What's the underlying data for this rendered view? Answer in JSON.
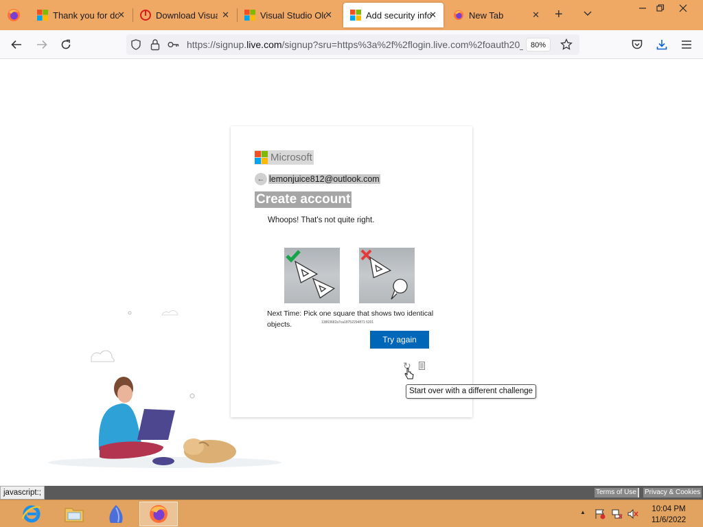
{
  "browser": {
    "tabs": [
      {
        "title": "Thank you for do",
        "icon": "microsoft-icon"
      },
      {
        "title": "Download Visual",
        "icon": "opera-icon"
      },
      {
        "title": "Visual Studio Old",
        "icon": "microsoft-icon"
      },
      {
        "title": "Add security info",
        "icon": "microsoft-icon",
        "active": true
      },
      {
        "title": "New Tab",
        "icon": "firefox-icon"
      }
    ],
    "close_glyph": "✕",
    "new_tab_glyph": "+",
    "url_prefix": "https://signup.",
    "url_domain": "live.com",
    "url_rest": "/signup?sru=https%3a%2f%2flogin.live.com%2foauth20_",
    "zoom": "80%"
  },
  "card": {
    "brand": "Microsoft",
    "email": "lemonjuice812@outlook.com",
    "back_glyph": "←",
    "title": "Create account",
    "error_message": "Whoops! That's not quite right.",
    "instruction": "Next Time: Pick one square that shows two identical objects.",
    "challenge_id": "13863682a7ca18752294871 5201",
    "try_again_label": "Try again",
    "refresh_glyph": "↻",
    "tooltip": "Start over with a different challenge"
  },
  "footer": {
    "status_text": "javascript:;",
    "terms_label": "Terms of Use",
    "privacy_label": "Privacy & Cookies"
  },
  "taskbar": {
    "time": "10:04 PM",
    "date": "11/6/2022"
  },
  "colors": {
    "tab_strip": "#f0a865",
    "taskbar": "#e1a35f",
    "primary_button": "#0067b8",
    "correct_mark": "#16a34a",
    "wrong_mark": "#e23b3b"
  }
}
